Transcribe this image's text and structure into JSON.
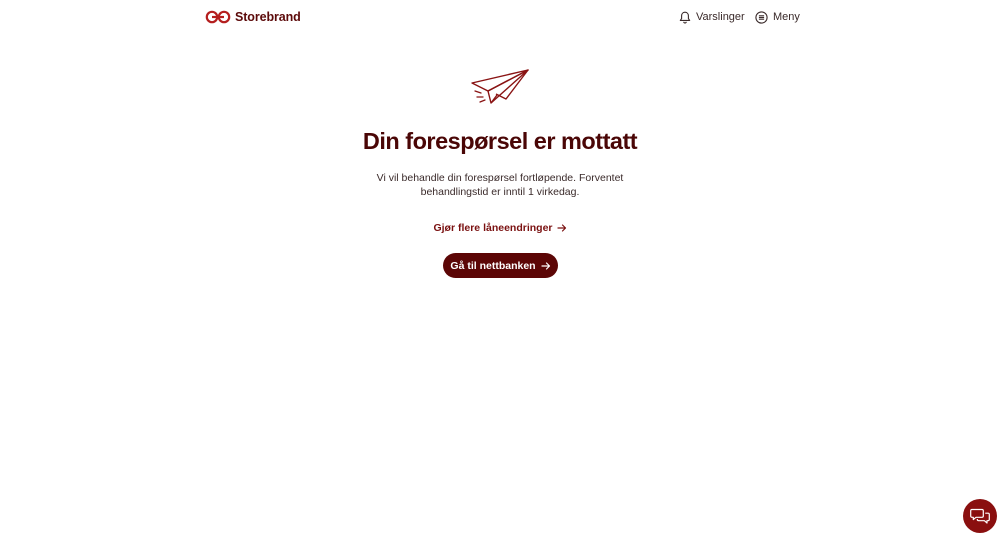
{
  "header": {
    "logo_text": "Storebrand",
    "logo_icon": "storebrand-logo-icon",
    "alerts": {
      "label": "Varslinger",
      "icon": "bell-icon"
    },
    "menu": {
      "label": "Meny",
      "icon": "menu-icon"
    }
  },
  "confirmation": {
    "illustration": "paper-plane-icon",
    "title": "Din forespørsel er mottatt",
    "message": "Vi vil behandle din forespørsel fortløpende. Forventet behandlingstid er inntil 1 virkedag.",
    "secondary_link": {
      "label": "Gjør flere låneendringer",
      "icon": "arrow-right-icon"
    },
    "primary_button": {
      "label": "Gå til nettbanken",
      "icon": "arrow-right-icon"
    }
  },
  "chat": {
    "icon": "chat-icon"
  },
  "colors": {
    "brand": "#5c0606",
    "title": "#4a0606",
    "link": "#7a1010",
    "chat": "#8a0f0f",
    "text": "#3a2a2a"
  }
}
